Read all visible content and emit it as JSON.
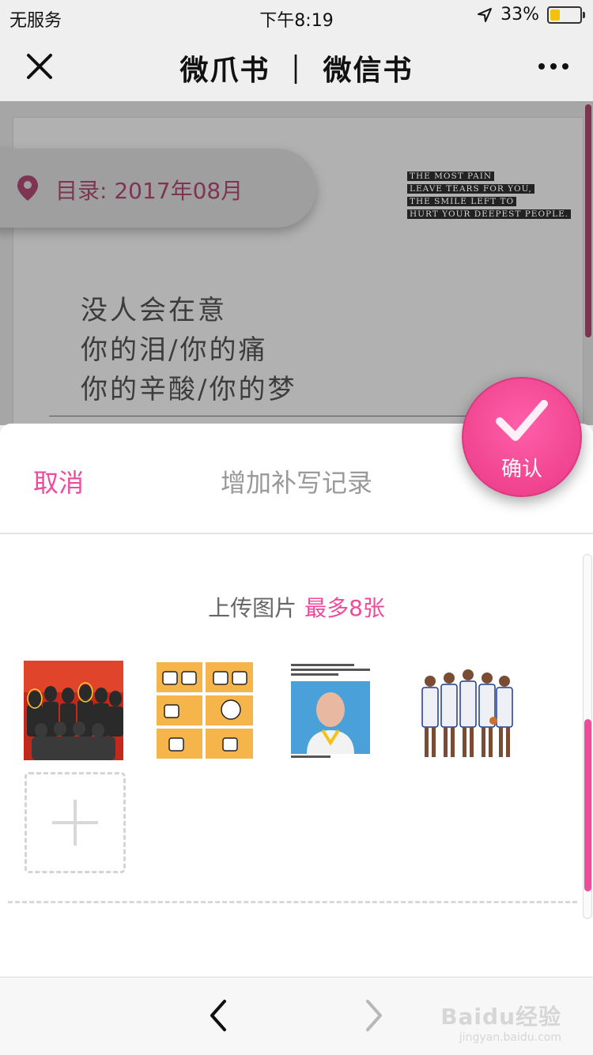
{
  "status_bar": {
    "carrier": "无服务",
    "time": "下午8:19",
    "battery_percent": "33%",
    "battery_level": 0.33
  },
  "nav": {
    "title": "微爪书 ｜ 微信书"
  },
  "background": {
    "catalog_label": "目录: 2017年08月",
    "quote_en": [
      "THE MOST PAIN",
      "LEAVE TEARS FOR YOU,",
      "THE SMILE LEFT TO",
      "HURT YOUR DEEPEST PEOPLE."
    ],
    "poem": [
      "没人会在意",
      "你的泪/你的痛",
      "你的辛酸/你的梦"
    ]
  },
  "sheet": {
    "cancel_label": "取消",
    "title": "增加补写记录",
    "confirm_label": "确认",
    "upload_label": "上传图片",
    "upload_limit": "最多8张",
    "photos": [
      {
        "description": "team-photo-red"
      },
      {
        "description": "comic-grid"
      },
      {
        "description": "player-portrait"
      },
      {
        "description": "team-photo-white"
      }
    ]
  },
  "toolbar": {
    "watermark": "Baidu经验",
    "watermark_sub": "jingyan.baidu.com"
  },
  "colors": {
    "accent": "#ef4a9c",
    "dim_overlay": "#a6a6a6",
    "catalog_text": "#7d3551"
  }
}
